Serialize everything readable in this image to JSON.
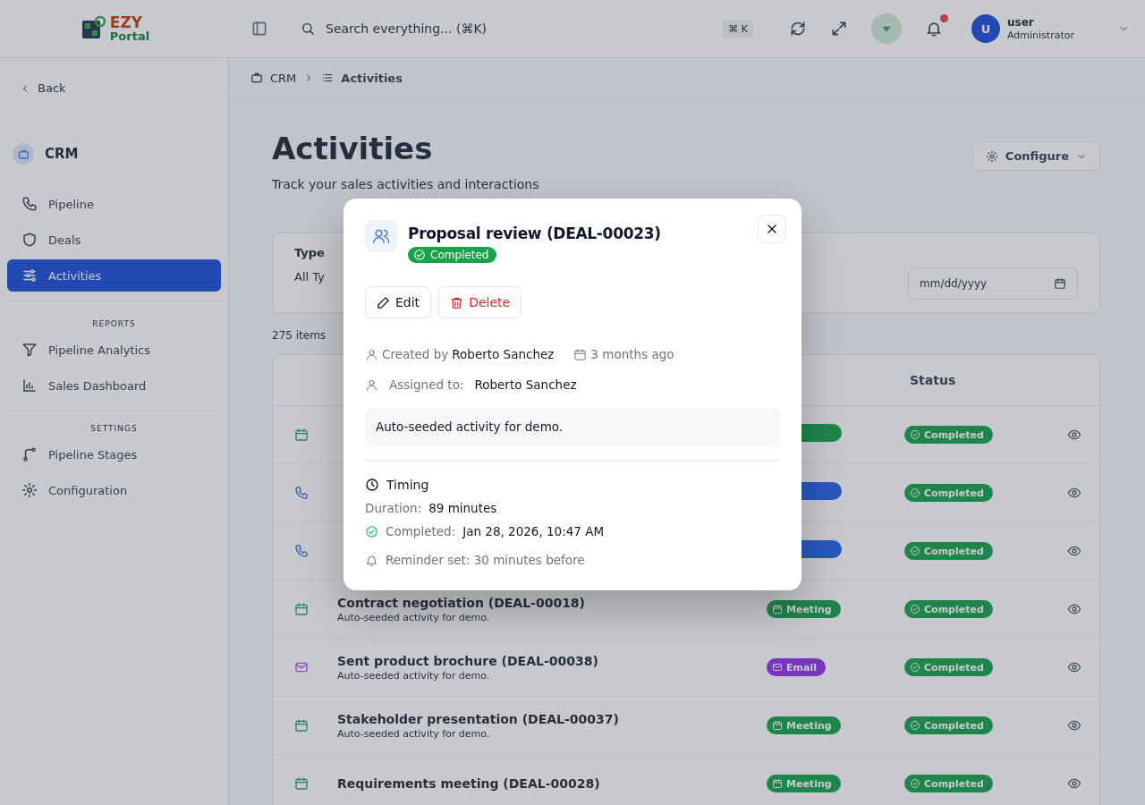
{
  "header": {
    "logo": {
      "line1": "EZY",
      "line2": "Portal"
    },
    "search": {
      "placeholder": "Search everything... (⌘K)"
    },
    "shortcut": "⌘ K",
    "user": {
      "initial": "U",
      "name": "user",
      "role": "Administrator"
    }
  },
  "sidebar": {
    "back": "Back",
    "module": "CRM",
    "sections": [
      {
        "items": [
          {
            "label": "Pipeline",
            "kind": "phone",
            "selected": false
          },
          {
            "label": "Deals",
            "kind": "shield",
            "selected": false
          },
          {
            "label": "Activities",
            "kind": "sliders",
            "selected": true
          }
        ]
      },
      {
        "heading": "REPORTS",
        "items": [
          {
            "label": "Pipeline Analytics",
            "kind": "funnel",
            "selected": false
          },
          {
            "label": "Sales Dashboard",
            "kind": "chart",
            "selected": false
          }
        ]
      },
      {
        "heading": "SETTINGS",
        "items": [
          {
            "label": "Pipeline Stages",
            "kind": "stages",
            "selected": false
          },
          {
            "label": "Configuration",
            "kind": "gear",
            "selected": false
          }
        ]
      }
    ]
  },
  "breadcrumb": [
    {
      "label": "CRM"
    },
    {
      "label": "Activities"
    }
  ],
  "page": {
    "title": "Activities",
    "subtitle": "Track your sales activities and interactions",
    "configure": "Configure"
  },
  "filters": {
    "type_label": "Type",
    "type_value": "All Ty",
    "date_placeholder": "mm/dd/yyyy"
  },
  "count": "275 items",
  "table": {
    "status_column": "Status",
    "rows": [
      {
        "kind": "meeting",
        "status": "Completed"
      },
      {
        "kind": "call",
        "status": "Completed"
      },
      {
        "kind": "call",
        "status": "Completed"
      },
      {
        "kind": "meeting",
        "name": "Contract negotiation (DEAL-00018)",
        "note": "Auto-seeded activity for demo.",
        "type": "Meeting",
        "status": "Completed"
      },
      {
        "kind": "email",
        "name": "Sent product brochure (DEAL-00038)",
        "note": "Auto-seeded activity for demo.",
        "type": "Email",
        "status": "Completed"
      },
      {
        "kind": "meeting",
        "name": "Stakeholder presentation (DEAL-00037)",
        "note": "Auto-seeded activity for demo.",
        "type": "Meeting",
        "status": "Completed"
      },
      {
        "kind": "meeting",
        "name": "Requirements meeting (DEAL-00028)",
        "type": "Meeting",
        "status": "Completed"
      }
    ]
  },
  "dialog": {
    "title": "Proposal review (DEAL-00023)",
    "status": "Completed",
    "actions": [
      {
        "label": "Edit",
        "kind": "edit"
      },
      {
        "label": "Delete",
        "kind": "delete"
      }
    ],
    "created_prefix": "Created by",
    "created_by": "Roberto Sanchez",
    "created_when": "3 months ago",
    "assigned_label": "Assigned to:",
    "assigned_to": "Roberto Sanchez",
    "description": "Auto-seeded activity for demo.",
    "timing": {
      "heading": "Timing",
      "duration_label": "Duration:",
      "duration": "89 minutes",
      "completed_label": "Completed:",
      "completed": "Jan 28, 2026, 10:47 AM",
      "reminder": "Reminder set: 30 minutes before"
    }
  }
}
